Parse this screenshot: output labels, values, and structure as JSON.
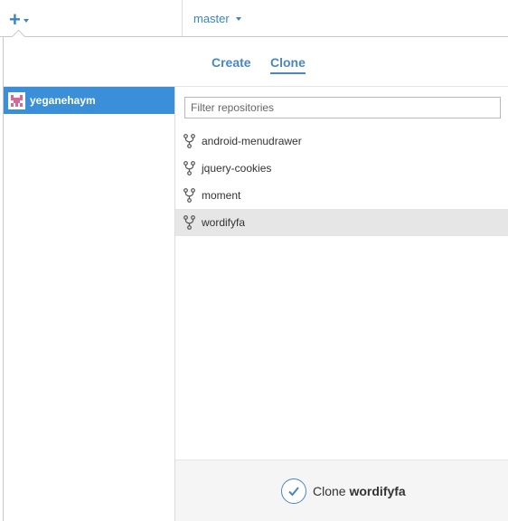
{
  "toolbar": {
    "add_icon": "plus-icon",
    "branch": "master"
  },
  "tabs": [
    {
      "label": "Create",
      "active": false
    },
    {
      "label": "Clone",
      "active": true
    }
  ],
  "sidebar": {
    "account": {
      "name": "yeganehaym",
      "selected": true
    }
  },
  "filter": {
    "placeholder": "Filter repositories",
    "value": ""
  },
  "repositories": [
    {
      "name": "android-menudrawer",
      "icon": "fork-icon",
      "selected": false
    },
    {
      "name": "jquery-cookies",
      "icon": "fork-icon",
      "selected": false
    },
    {
      "name": "moment",
      "icon": "fork-icon",
      "selected": false
    },
    {
      "name": "wordifyfa",
      "icon": "fork-icon",
      "selected": true
    }
  ],
  "footer": {
    "verb": "Clone",
    "target": "wordifyfa",
    "icon": "checkmark-circle-icon"
  },
  "colors": {
    "accent": "#3b84c4",
    "selected_account_bg": "#3b8fd8",
    "selected_repo_bg": "#e6e6e6"
  }
}
